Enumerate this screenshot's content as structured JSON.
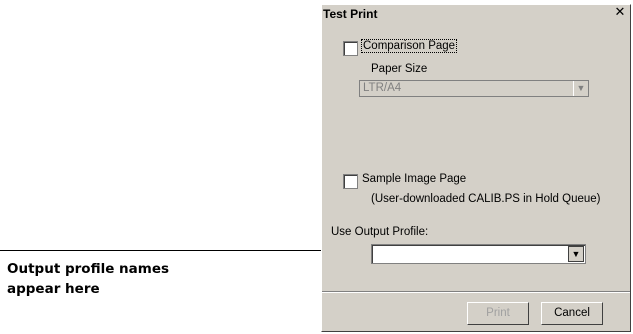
{
  "callout": {
    "line1": "Output profile names",
    "line2": "appear here"
  },
  "dialog": {
    "title": "Test Print",
    "close_glyph": "✕",
    "comparison_page_label": "Comparison Page",
    "comparison_checked": false,
    "paper_size_label": "Paper Size",
    "paper_size_value": "LTR/A4",
    "sample_image_label": "Sample Image Page",
    "sample_image_note": "(User-downloaded CALIB.PS in Hold Queue)",
    "sample_checked": false,
    "output_profile_label": "Use Output Profile:",
    "output_profile_value": "",
    "dropdown_glyph": "▼",
    "print_label": "Print",
    "cancel_label": "Cancel"
  }
}
